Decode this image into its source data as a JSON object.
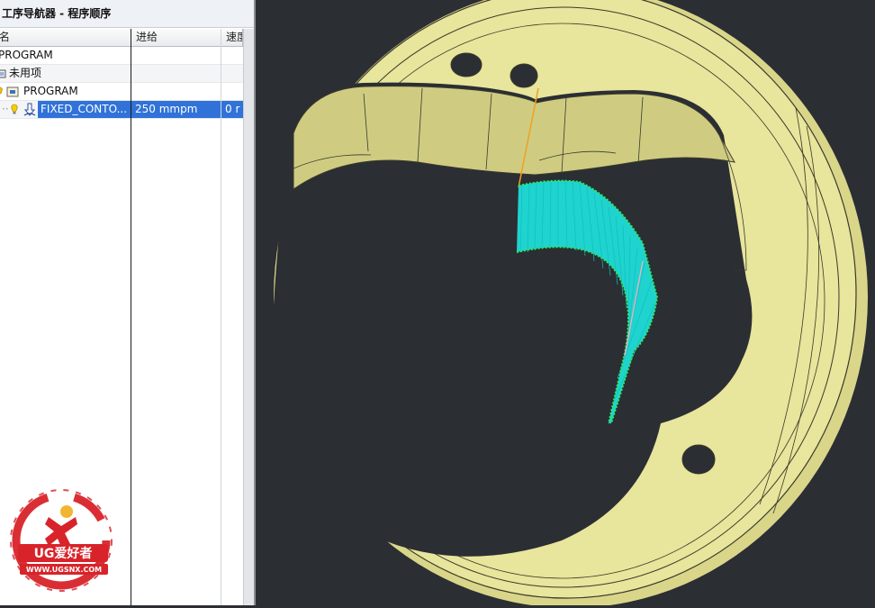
{
  "navigator": {
    "title": "工序导航器 - 程序顺序",
    "columns": {
      "name": "名",
      "feed": "进给",
      "speed": "速度"
    },
    "rows": [
      {
        "name": "PROGRAM",
        "feed": "",
        "speed": "",
        "icon": "none"
      },
      {
        "name": "未用项",
        "feed": "",
        "speed": "",
        "icon": "unused-folder-icon"
      },
      {
        "name": "PROGRAM",
        "feed": "",
        "speed": "",
        "icon": "program-folder-icon"
      },
      {
        "name": "FIXED_CONTO...",
        "feed": "250 mmpm",
        "speed": "0 r",
        "icon": "fixed-contour-operation-icon",
        "selected": true
      }
    ]
  },
  "watermark": {
    "brand": "UG爱好者",
    "url": "WWW.UGSNX.COM"
  },
  "colors": {
    "part": "#e8e59c",
    "part_dark": "#c9c67a",
    "toolpath": "#1ee6e0",
    "toolpath_edge": "#2de85a",
    "engage": "#f0a020",
    "selection": "#3072d8",
    "background": "#2b2e33"
  }
}
